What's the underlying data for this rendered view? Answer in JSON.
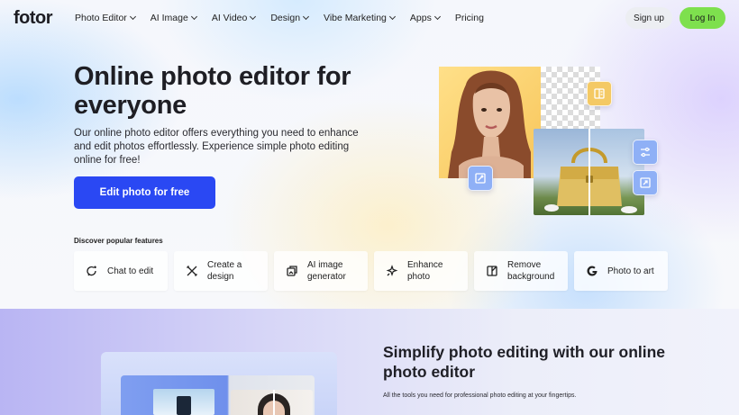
{
  "nav": {
    "logo": "fotor",
    "menu": [
      {
        "label": "Photo Editor",
        "dropdown": true
      },
      {
        "label": "AI Image",
        "dropdown": true
      },
      {
        "label": "AI Video",
        "dropdown": true
      },
      {
        "label": "Design",
        "dropdown": true
      },
      {
        "label": "Vibe Marketing",
        "dropdown": true
      },
      {
        "label": "Apps",
        "dropdown": true
      },
      {
        "label": "Pricing",
        "dropdown": false
      }
    ],
    "signup_label": "Sign up",
    "login_label": "Log In"
  },
  "hero": {
    "headline": "Online photo editor for everyone",
    "subtext": "Our online photo editor offers everything you need to enhance and edit photos effortlessly. Experience simple photo editing online for free!",
    "cta_label": "Edit photo for free",
    "features_title": "Discover popular features",
    "features": [
      {
        "label": "Chat to edit",
        "icon": "chat-edit-icon"
      },
      {
        "label": "Create a design",
        "icon": "design-tools-icon"
      },
      {
        "label": "AI image generator",
        "icon": "image-generator-icon"
      },
      {
        "label": "Enhance photo",
        "icon": "enhance-sparkle-icon"
      },
      {
        "label": "Remove background",
        "icon": "remove-background-icon"
      },
      {
        "label": "Photo to art",
        "icon": "photo-art-icon"
      }
    ]
  },
  "section2": {
    "title": "Simplify photo editing with our online photo editor",
    "subtitle": "All the tools you need for professional photo editing at your fingertips."
  },
  "colors": {
    "cta": "#2a48f3",
    "login": "#7ee04e",
    "tool_tile": "#8fb0f6"
  }
}
